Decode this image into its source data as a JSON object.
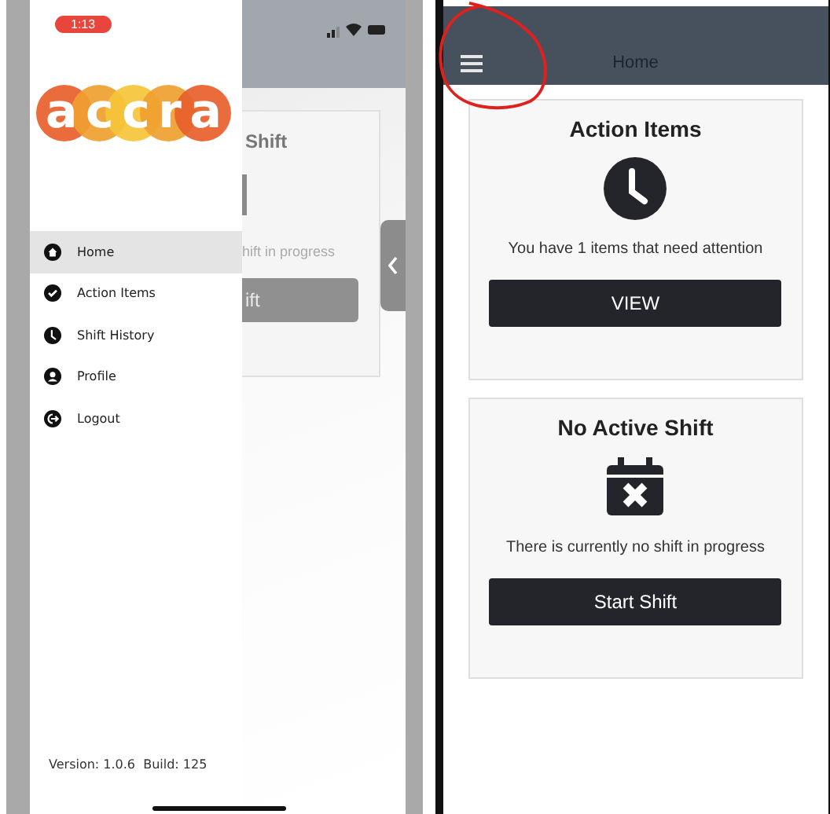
{
  "left_screen": {
    "status_bar": {
      "time": "1:13"
    },
    "drawer": {
      "logo": "accra",
      "items": [
        {
          "label": "Home",
          "kind": "home",
          "selected": true
        },
        {
          "label": "Action Items",
          "kind": "check",
          "selected": false
        },
        {
          "label": "Shift History",
          "kind": "clock",
          "selected": false
        },
        {
          "label": "Profile",
          "kind": "user",
          "selected": false
        },
        {
          "label": "Logout",
          "kind": "logout",
          "selected": false
        }
      ],
      "version": "Version: 1.0.6  Build: 125"
    },
    "behind": {
      "card_title": "Shift",
      "message": "hift in progress",
      "button": "ift"
    }
  },
  "right_screen": {
    "header": {
      "title": "Home"
    },
    "cards": [
      {
        "title": "Action Items",
        "kind": "clock",
        "message": "You have 1 items that need attention",
        "button": "VIEW"
      },
      {
        "title": "No Active Shift",
        "kind": "calendar-x",
        "message": "There is currently no shift in progress",
        "button": "Start Shift"
      }
    ]
  }
}
